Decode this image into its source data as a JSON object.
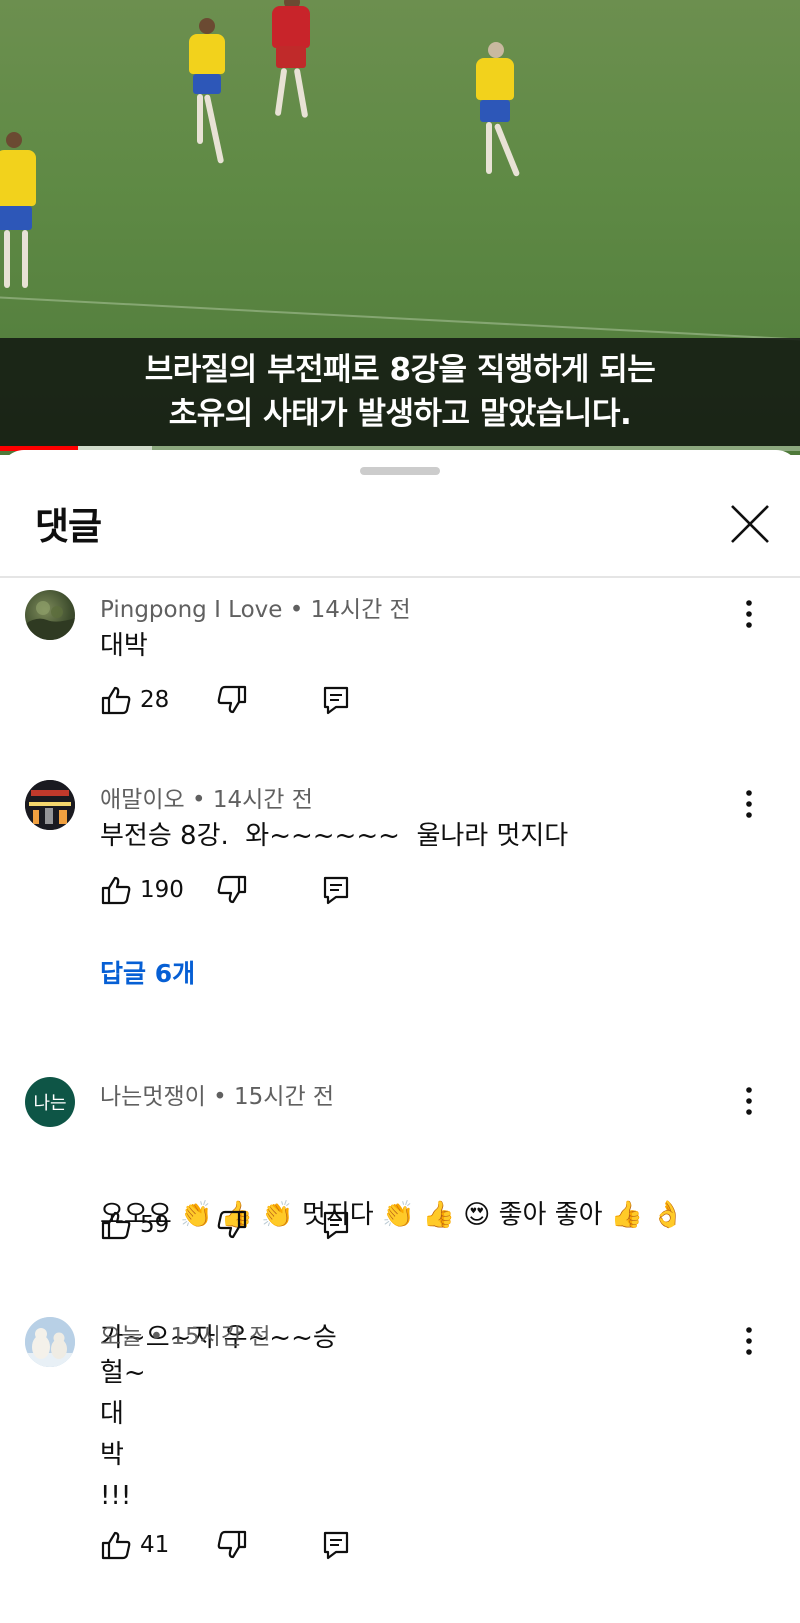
{
  "video": {
    "subtitle_line1": "브라질의 부전패로 8강을 직행하게 되는",
    "subtitle_line2": "초유의 사태가 발생하고 말았습니다.",
    "progress_played_fraction": 0.098,
    "progress_buffered_fraction": 0.19
  },
  "comments_panel": {
    "title": "댓글",
    "close_icon": "close-icon",
    "comments": [
      {
        "author": "Pingpong I Love",
        "time": "14시간 전",
        "text": "대박",
        "likes": "28",
        "avatar": "landscape-photo"
      },
      {
        "author": "애말이오",
        "time": "14시간 전",
        "text": "부전승 8강.  와~~~~~~  울나라 멋지다",
        "likes": "190",
        "avatar": "night-city-photo",
        "replies_label": "답글 6개"
      },
      {
        "author": "나는멋쟁이",
        "time": "15시간 전",
        "text_line1": "오오오 👏 👍 👏 멋지다 👏 👍 😍 좋아 좋아 👍 👌",
        "text_line2": "가~으~자 우~~~승",
        "likes": "59",
        "avatar_text": "나는",
        "avatar_color": "#0e5546"
      },
      {
        "author": "오늘",
        "time": "15시간 전",
        "text": "헐~\n대\n박\n!!!",
        "likes": "41",
        "avatar": "polar-bears-photo"
      }
    ]
  },
  "colors": {
    "accent_link": "#065fd4",
    "progress_red": "#ff0000",
    "meta_gray": "#606060"
  },
  "separator": " • "
}
